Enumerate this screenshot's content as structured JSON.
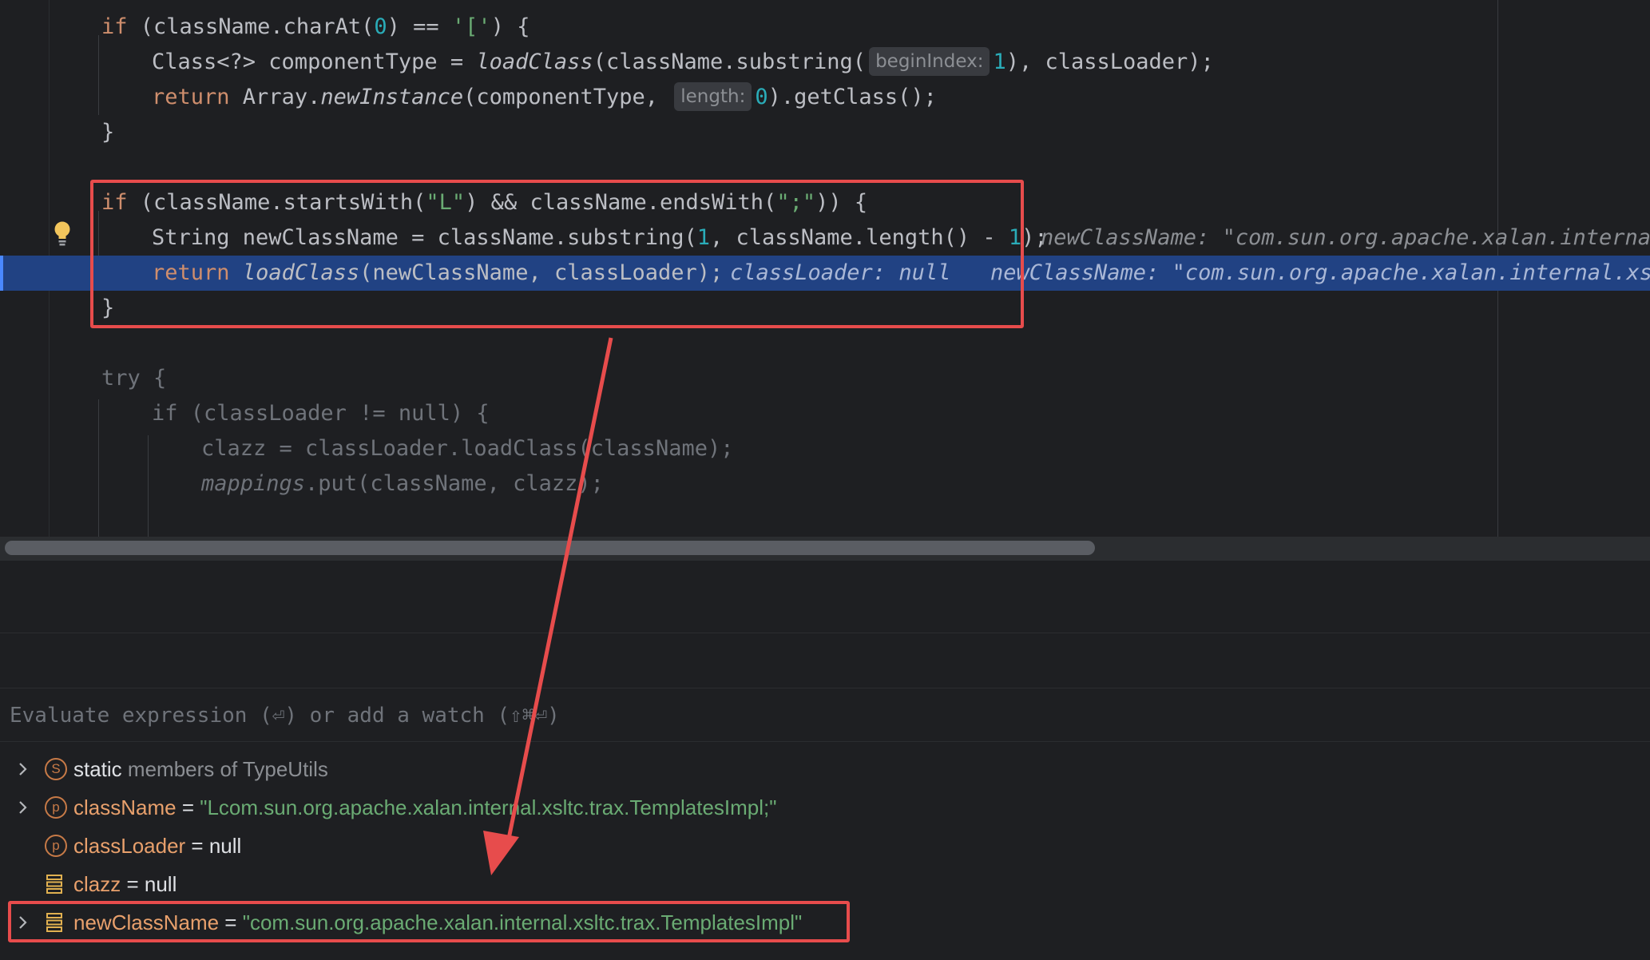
{
  "code": {
    "line1": {
      "kw1": "if",
      "t1": " (className.charAt(",
      "n1": "0",
      "t2": ") == ",
      "s1": "'['",
      "t3": ") {"
    },
    "line2": {
      "t1": "Class<?> componentType = ",
      "m1": "loadClass",
      "t2": "(className.substring(",
      "hint": "beginIndex:",
      "n1": "1",
      "t3": "), classLoader);"
    },
    "line3": {
      "kw1": "return",
      "t1": " Array.",
      "m1": "newInstance",
      "t2": "(componentType, ",
      "hint": "length:",
      "n1": "0",
      "t3": ").getClass();"
    },
    "line4": {
      "t1": "}"
    },
    "line6": {
      "kw1": "if",
      "t1": " (className.startsWith(",
      "s1": "\"L\"",
      "t2": ") && className.endsWith(",
      "s2": "\";\"",
      "t3": ")) {"
    },
    "line7": {
      "t1": "String newClassName = className.substring(",
      "n1": "1",
      "t2": ", className.length() - ",
      "n2": "1",
      "t3": ");",
      "inline": "newClassName: \"com.sun.org.apache.xalan.internal."
    },
    "line8": {
      "kw1": "return",
      "m1": "loadClass",
      "t1": "(newClassName, classLoader);",
      "inline1": "classLoader: null",
      "inline2": "newClassName: \"com.sun.org.apache.xalan.internal.xsltc."
    },
    "line9": {
      "t1": "}"
    },
    "line11": {
      "kw1": "try",
      "t1": " {"
    },
    "line12": {
      "kw1": "if",
      "t1": " (classLoader != null) {"
    },
    "line13": {
      "t1": "clazz = classLoader.loadClass(className);"
    },
    "line14": {
      "m1": "mappings",
      "t1": ".put(className, clazz);"
    }
  },
  "evaluate": {
    "placeholder": "Evaluate expression (⏎) or add a watch (⇧⌘⏎)"
  },
  "variables": [
    {
      "badge": "S",
      "name": "static",
      "rest": " members of TypeUtils"
    },
    {
      "badge": "p",
      "name": "className",
      "eq": " = ",
      "value": "\"Lcom.sun.org.apache.xalan.internal.xsltc.trax.TemplatesImpl;\""
    },
    {
      "badge": "p",
      "name": "classLoader",
      "eq": " = ",
      "value": "null"
    },
    {
      "name": "clazz",
      "eq": " = ",
      "value": "null"
    },
    {
      "name": "newClassName",
      "eq": " = ",
      "value": "\"com.sun.org.apache.xalan.internal.xsltc.trax.TemplatesImpl\""
    }
  ],
  "colors": {
    "annotation": "#e74c4c",
    "execution_line": "#214283",
    "background": "#1e1f22"
  }
}
